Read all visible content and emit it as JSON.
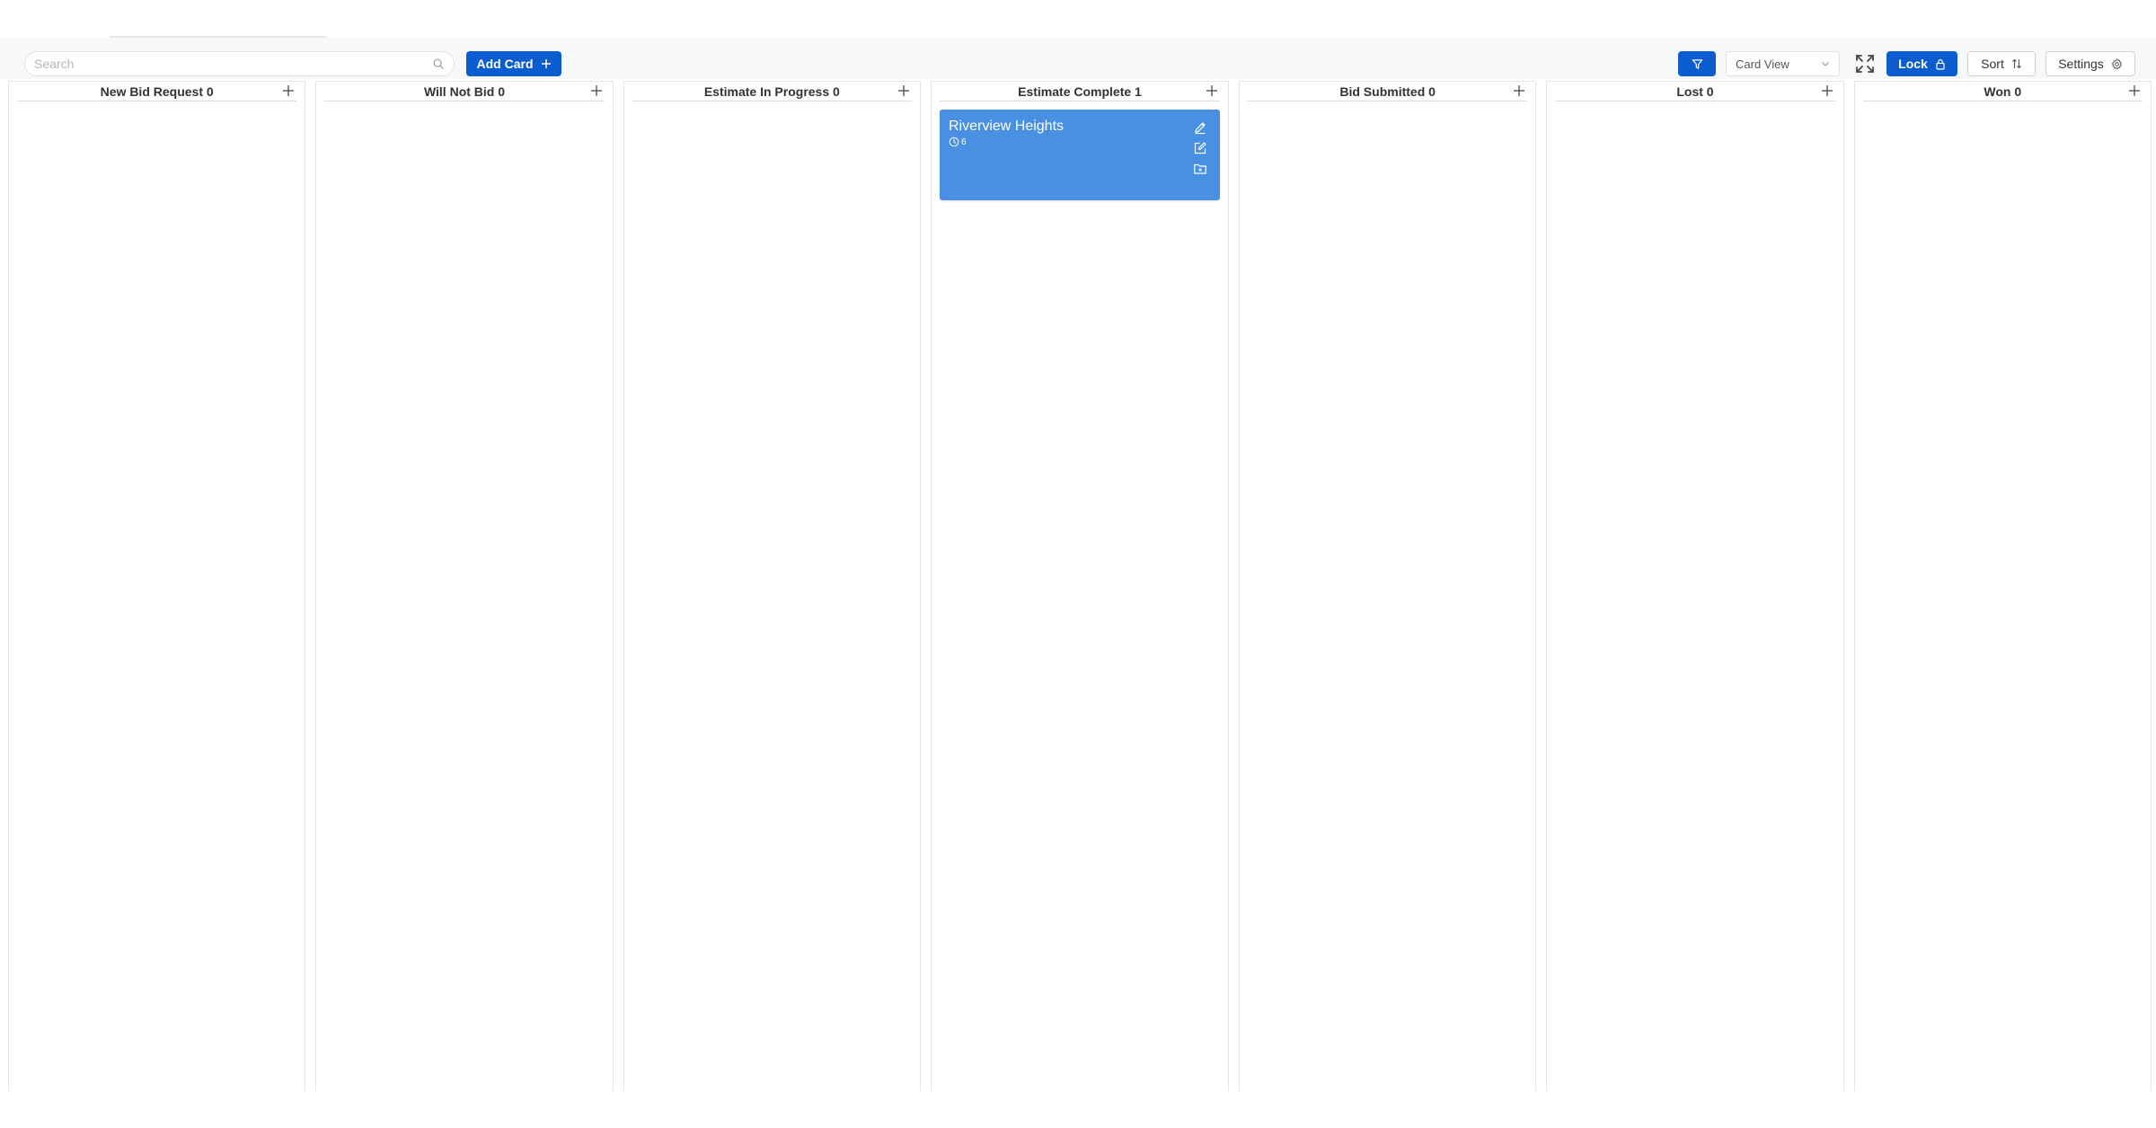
{
  "toolbar": {
    "search_placeholder": "Search",
    "add_card_label": "Add Card",
    "view_select_value": "Card View",
    "lock_label": "Lock",
    "sort_label": "Sort",
    "settings_label": "Settings",
    "primary_color": "#0b5cce"
  },
  "columns": [
    {
      "title": "New Bid Request 0"
    },
    {
      "title": "Will Not Bid 0"
    },
    {
      "title": "Estimate In Progress 0"
    },
    {
      "title": "Estimate Complete 1"
    },
    {
      "title": "Bid Submitted 0"
    },
    {
      "title": "Lost 0"
    },
    {
      "title": "Won 0"
    }
  ],
  "cards": [
    {
      "column": "Estimate Complete 1",
      "title": "Riverview Heights",
      "count": "6",
      "color": "#4a90e2"
    }
  ]
}
